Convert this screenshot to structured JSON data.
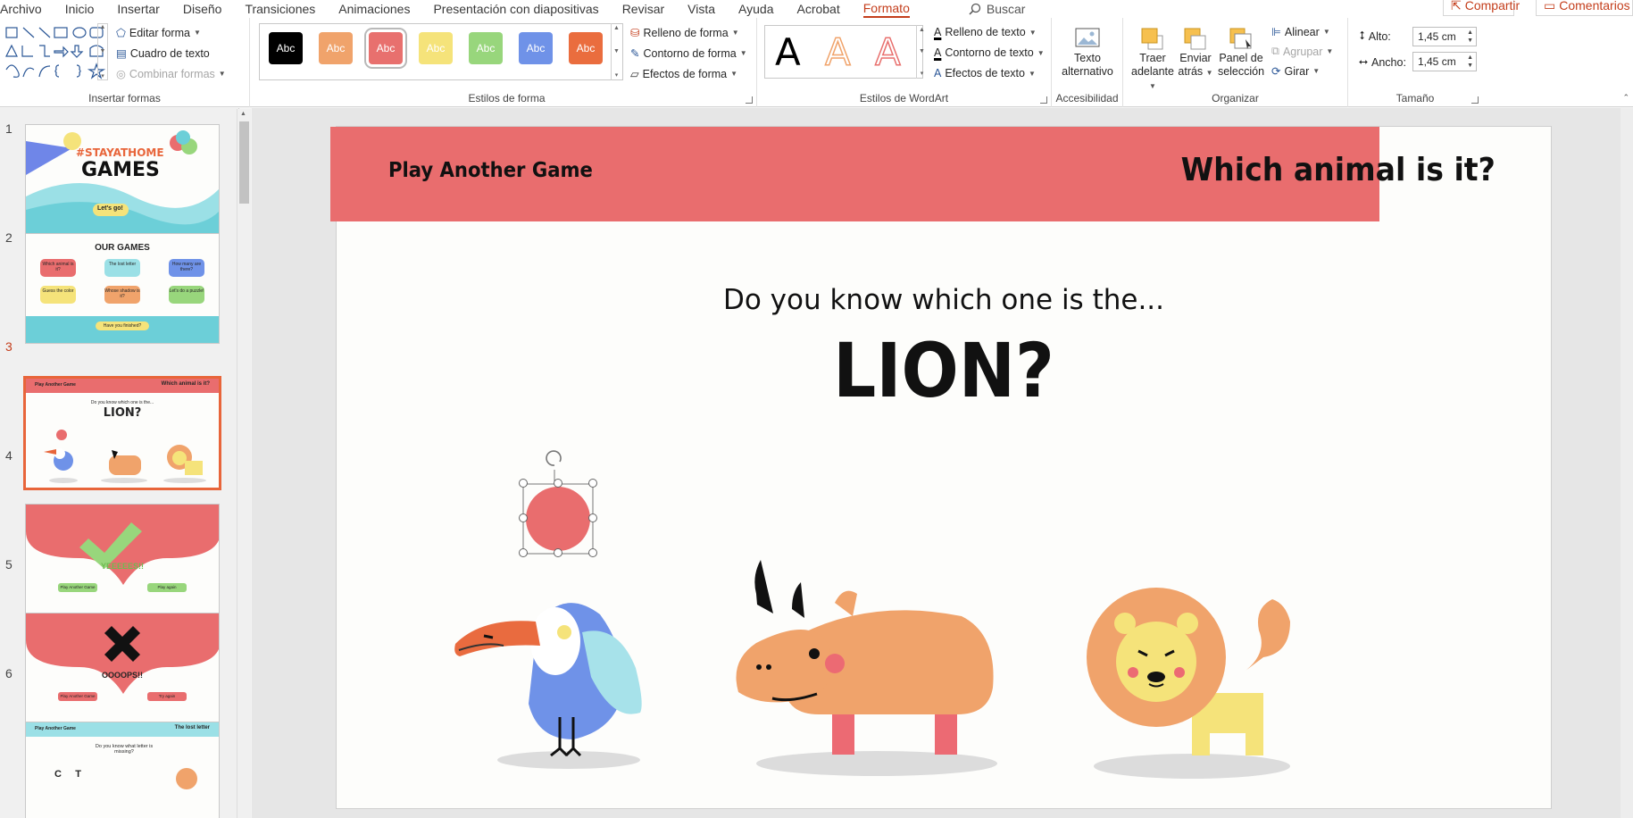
{
  "tabs": [
    "Archivo",
    "Inicio",
    "Insertar",
    "Diseño",
    "Transiciones",
    "Animaciones",
    "Presentación con diapositivas",
    "Revisar",
    "Vista",
    "Ayuda",
    "Acrobat",
    "Formato"
  ],
  "active_tab": "Formato",
  "search_label": "Buscar",
  "share_label": "Compartir",
  "comments_label": "Comentarios",
  "ribbon": {
    "insert_shapes": {
      "label": "Insertar formas",
      "edit_shape": "Editar forma",
      "text_box": "Cuadro de texto",
      "merge_shapes": "Combinar formas"
    },
    "shape_styles": {
      "label": "Estilos de forma",
      "swatch_text": "Abc",
      "swatch_colors": [
        "#000000",
        "#f0a36b",
        "#e8706e",
        "#f5e37a",
        "#98d67c",
        "#6f92e8",
        "#ea6d3e"
      ],
      "fill": "Relleno de forma",
      "outline": "Contorno de forma",
      "effects": "Efectos de forma"
    },
    "wordart": {
      "label": "Estilos de WordArt",
      "letter": "A",
      "text_fill": "Relleno de texto",
      "text_outline": "Contorno de texto",
      "text_effects": "Efectos de texto"
    },
    "accessibility": {
      "label": "Accesibilidad",
      "alt_text_line1": "Texto",
      "alt_text_line2": "alternativo"
    },
    "arrange": {
      "label": "Organizar",
      "bring_forward_1": "Traer",
      "bring_forward_2": "adelante",
      "send_back_1": "Enviar",
      "send_back_2": "atrás",
      "selection_pane_1": "Panel de",
      "selection_pane_2": "selección",
      "align": "Alinear",
      "group": "Agrupar",
      "rotate": "Girar"
    },
    "size": {
      "label": "Tamaño",
      "height_label": "Alto:",
      "height_value": "1,45 cm",
      "width_label": "Ancho:",
      "width_value": "1,45 cm"
    }
  },
  "slides": {
    "numbers": [
      "1",
      "2",
      "3",
      "4",
      "5",
      "6"
    ],
    "active": "3",
    "s1": {
      "hashtag": "#STAYATHOME",
      "title": "GAMES",
      "button": "Let's go!"
    },
    "s2": {
      "title": "OUR GAMES",
      "games": [
        "Which animal is it?",
        "The lost letter",
        "How many are there?",
        "Guess the color",
        "Whose shadow is it?",
        "Let's do a puzzle!"
      ],
      "finish": "Have you finished?"
    },
    "s3": {
      "left": "Play Another Game",
      "right": "Which animal is it?",
      "question": "Do you know which one is the...",
      "answer": "LION?"
    },
    "s4": {
      "text": "YEEEEES!!",
      "btn1": "Play Another Game",
      "btn2": "Play again"
    },
    "s5": {
      "text": "OOOOPS!!",
      "btn1": "Play Another Game",
      "btn2": "Try again"
    },
    "s6": {
      "left": "Play Another Game",
      "right": "The lost letter",
      "question": "Do you know what letter is missing?",
      "letters": "C     T"
    }
  },
  "current_slide": {
    "header_left": "Play Another Game",
    "header_right": "Which animal is it?",
    "question": "Do you know which one is the...",
    "answer": "LION?",
    "header_color": "#e96d6e",
    "circle_color": "#e96d6e"
  }
}
